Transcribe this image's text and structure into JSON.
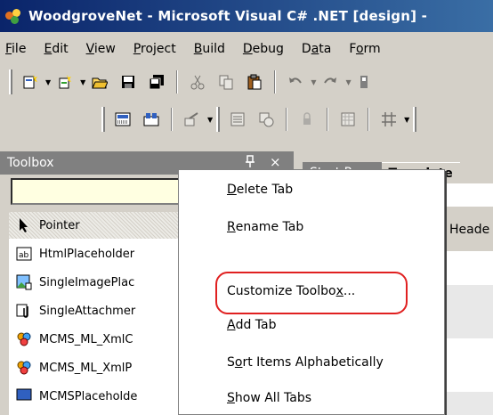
{
  "window": {
    "title": "WoodgroveNet - Microsoft Visual C# .NET [design] - "
  },
  "menu": [
    {
      "label": "File",
      "key": "F",
      "rest": "ile"
    },
    {
      "label": "Edit",
      "key": "E",
      "rest": "dit"
    },
    {
      "label": "View",
      "key": "V",
      "rest": "iew"
    },
    {
      "label": "Project",
      "key": "P",
      "rest": "roject"
    },
    {
      "label": "Build",
      "key": "B",
      "rest": "uild"
    },
    {
      "label": "Debug",
      "key": "D",
      "rest": "ebug"
    },
    {
      "label": "Data",
      "pre": "D",
      "key": "a",
      "rest": "ta"
    },
    {
      "label": "Form",
      "pre": "F",
      "key": "o",
      "rest": "rm"
    }
  ],
  "toolbox": {
    "title": "Toolbox",
    "pin_glyph": "•",
    "close_glyph": "×",
    "items": [
      {
        "label": "Pointer",
        "icon": "pointer-icon"
      },
      {
        "label": "HtmlPlaceholder",
        "icon": "html-placeholder-icon"
      },
      {
        "label": "SingleImagePlac",
        "icon": "image-placeholder-icon"
      },
      {
        "label": "SingleAttachmer",
        "icon": "attachment-icon"
      },
      {
        "label": "MCMS_ML_XmlC",
        "icon": "component-icon"
      },
      {
        "label": "MCMS_ML_XmlP",
        "icon": "component-icon"
      },
      {
        "label": "MCMSPlaceholde",
        "icon": "component-icon"
      }
    ]
  },
  "document": {
    "tabs": [
      {
        "label": "Start Page"
      },
      {
        "label": "Template"
      }
    ],
    "header_text": "Heade"
  },
  "context_menu": {
    "items": [
      {
        "label": "Delete Tab",
        "key": "D",
        "rest": "elete Tab"
      },
      {
        "label": "Rename Tab",
        "key": "R",
        "rest": "ename Tab"
      },
      {
        "label": "Customize Toolbox...",
        "pre": "Customize Toolbo",
        "key": "x",
        "rest": "..."
      },
      {
        "label": "Add Tab",
        "key": "A",
        "rest": "dd Tab"
      },
      {
        "label": "Sort Items Alphabetically",
        "pre": "S",
        "key": "o",
        "rest": "rt Items Alphabetically"
      },
      {
        "label": "Show All Tabs",
        "key": "S",
        "rest": "how All Tabs"
      }
    ],
    "highlighted_index": 2
  },
  "colors": {
    "highlight_ring": "#e02020",
    "titlebar_start": "#0a246a",
    "titlebar_end": "#3a6ea5"
  }
}
